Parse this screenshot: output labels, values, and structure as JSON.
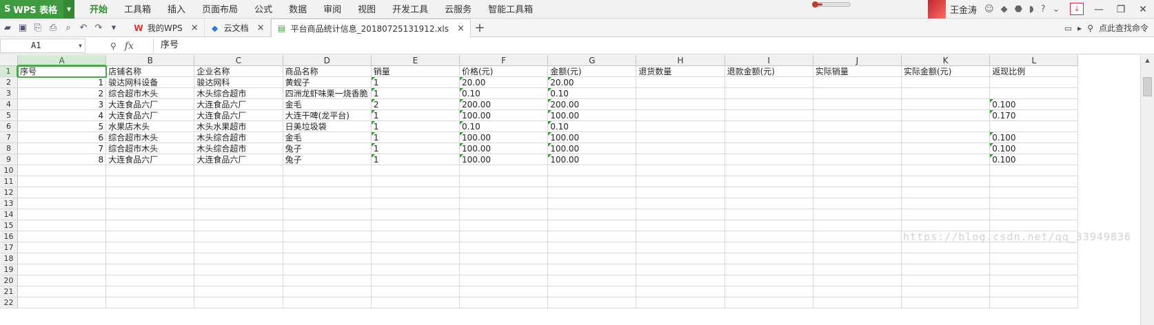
{
  "app": {
    "name": "WPS 表格",
    "logo": "S",
    "menu": [
      "开始",
      "工具箱",
      "插入",
      "页面布局",
      "公式",
      "数据",
      "审阅",
      "视图",
      "开发工具",
      "云服务",
      "智能工具箱"
    ],
    "active_menu": "开始",
    "user": "王金涛"
  },
  "tabs": [
    {
      "label": "我的WPS",
      "icon": "wps-icon"
    },
    {
      "label": "云文档",
      "icon": "cloud-doc-icon"
    },
    {
      "label": "平台商品统计信息_20180725131912.xls",
      "icon": "sheet-icon",
      "active": true
    }
  ],
  "search_hint": "点此查找命令",
  "formula_bar": {
    "cell_ref": "A1",
    "content": "序号"
  },
  "sheet": {
    "columns": [
      "A",
      "B",
      "C",
      "D",
      "E",
      "F",
      "G",
      "H",
      "I",
      "J",
      "K",
      "L"
    ],
    "row_numbers": [
      "1",
      "2",
      "3",
      "4",
      "5",
      "6",
      "7",
      "8",
      "9",
      "10",
      "11",
      "12",
      "13",
      "14",
      "15",
      "16",
      "17",
      "18",
      "19",
      "20",
      "21",
      "22"
    ],
    "header_row": [
      "序号",
      "店铺名称",
      "企业名称",
      "商品名称",
      "销量",
      "价格(元)",
      "金额(元)",
      "退货数量",
      "退款金额(元)",
      "实际销量",
      "实际金额(元)",
      "返现比例"
    ],
    "rows": [
      [
        "1",
        "骏达网科设备",
        "骏达网科",
        "黄蚬子",
        "1",
        "20.00",
        "20.00",
        "",
        "",
        "",
        "",
        ""
      ],
      [
        "2",
        "综合超市木头",
        "木头综合超市",
        "四洲龙虾味栗一烧香脆",
        "1",
        "0.10",
        "0.10",
        "",
        "",
        "",
        "",
        ""
      ],
      [
        "3",
        "大连食品六厂",
        "大连食品六厂",
        "金毛",
        "2",
        "200.00",
        "200.00",
        "",
        "",
        "",
        "",
        "0.100"
      ],
      [
        "4",
        "大连食品六厂",
        "大连食品六厂",
        "大连干啤(龙平台)",
        "1",
        "100.00",
        "100.00",
        "",
        "",
        "",
        "",
        "0.170"
      ],
      [
        "5",
        "水果店木头",
        "木头水果超市",
        "日美垃圾袋",
        "1",
        "0.10",
        "0.10",
        "",
        "",
        "",
        "",
        ""
      ],
      [
        "6",
        "综合超市木头",
        "木头综合超市",
        "金毛",
        "1",
        "100.00",
        "100.00",
        "",
        "",
        "",
        "",
        "0.100"
      ],
      [
        "7",
        "综合超市木头",
        "木头综合超市",
        "兔子",
        "1",
        "100.00",
        "100.00",
        "",
        "",
        "",
        "",
        "0.100"
      ],
      [
        "8",
        "大连食品六厂",
        "大连食品六厂",
        "兔子",
        "1",
        "100.00",
        "100.00",
        "",
        "",
        "",
        "",
        "0.100"
      ]
    ]
  },
  "watermark": "https://blog.csdn.net/qq_33949836",
  "colors": {
    "app_green": "#3f9b3f",
    "selection": "#4aa84a",
    "text_num_flag": "#2d9b2d"
  }
}
